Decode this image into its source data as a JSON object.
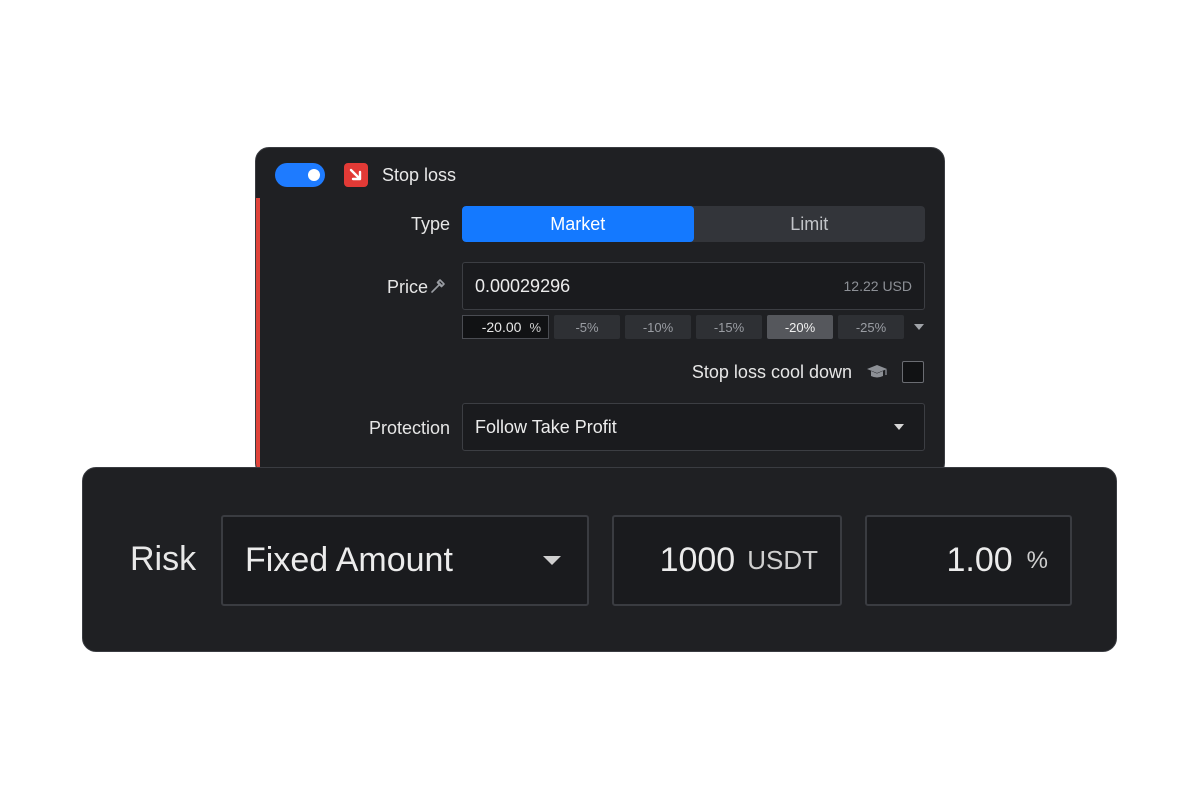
{
  "stop_loss": {
    "enabled": true,
    "title": "Stop loss",
    "accent_color": "#e23a36",
    "toggle_color": "#1e7bff",
    "type": {
      "label": "Type",
      "options": [
        "Market",
        "Limit"
      ],
      "selected": "Market"
    },
    "price": {
      "label": "Price",
      "value": "0.00029296",
      "usd_value": "12.22 USD",
      "percent_value": "-20.00",
      "percent_unit": "%",
      "chips": [
        "-5%",
        "-10%",
        "-15%",
        "-20%",
        "-25%"
      ],
      "selected_chip": "-20%"
    },
    "cooldown": {
      "label": "Stop loss cool down",
      "checked": false
    },
    "protection": {
      "label": "Protection",
      "value": "Follow Take Profit"
    }
  },
  "risk": {
    "label": "Risk",
    "mode": "Fixed Amount",
    "amount": "1000",
    "amount_unit": "USDT",
    "percent": "1.00",
    "percent_unit": "%"
  },
  "icons": {
    "toggle": "toggle-switch",
    "stop_loss": "arrow-down-right-icon",
    "price_pick": "pipette-icon",
    "cooldown_info": "graduation-cap-icon",
    "dropdown": "caret-down-icon"
  }
}
